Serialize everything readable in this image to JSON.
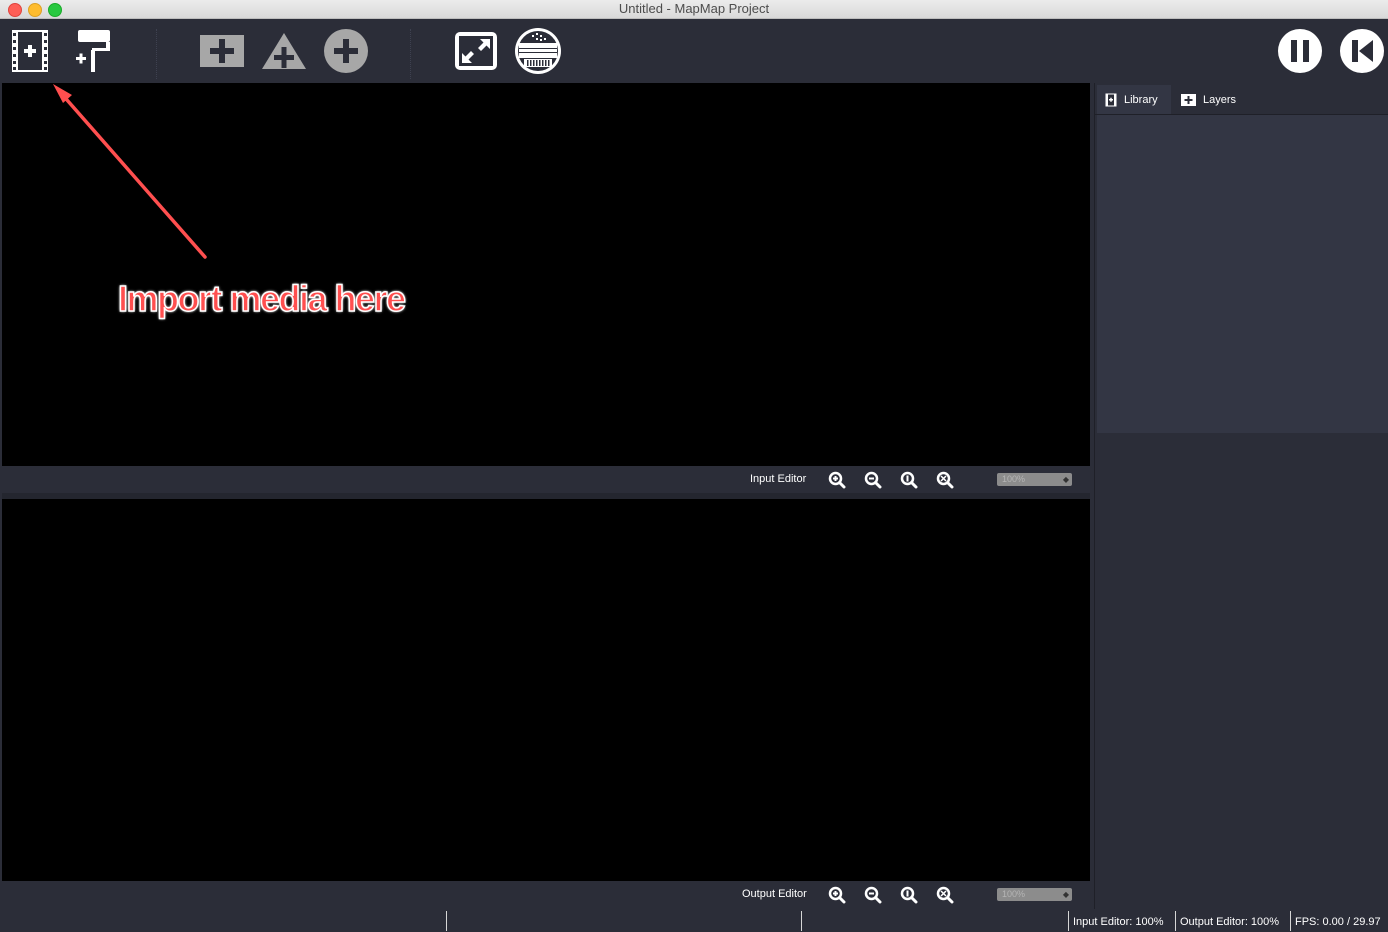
{
  "window": {
    "title": "Untitled - MapMap Project"
  },
  "toolbar": {
    "buttons": [
      {
        "name": "import-media-button",
        "icon": "film-add-icon"
      },
      {
        "name": "add-paint-button",
        "icon": "paint-roller-add-icon"
      },
      {
        "name": "add-mesh-button",
        "icon": "square-plus-icon"
      },
      {
        "name": "add-triangle-button",
        "icon": "triangle-plus-icon"
      },
      {
        "name": "add-ellipse-button",
        "icon": "circle-plus-icon"
      },
      {
        "name": "fullscreen-button",
        "icon": "expand-icon"
      },
      {
        "name": "test-signal-button",
        "icon": "test-pattern-icon"
      },
      {
        "name": "pause-button",
        "icon": "pause-icon"
      },
      {
        "name": "rewind-button",
        "icon": "skip-back-icon"
      }
    ]
  },
  "input_editor": {
    "label": "Input Editor",
    "zoom_value": "100%"
  },
  "output_editor": {
    "label": "Output Editor",
    "zoom_value": "100%"
  },
  "right_panel": {
    "tabs": [
      {
        "label": "Library",
        "icon": "film-icon",
        "selected": true
      },
      {
        "label": "Layers",
        "icon": "plus-box-icon",
        "selected": false
      }
    ]
  },
  "status": {
    "input_zoom": "Input Editor: 100%",
    "output_zoom": "Output Editor: 100%",
    "fps": "FPS: 0.00 / 29.97"
  },
  "annotation": {
    "text": "Import media here",
    "color": "#ff4f4f"
  },
  "colors": {
    "background": "#2b2d38",
    "canvas": "#000000",
    "panel": "#333644",
    "icon": "#ffffff"
  }
}
